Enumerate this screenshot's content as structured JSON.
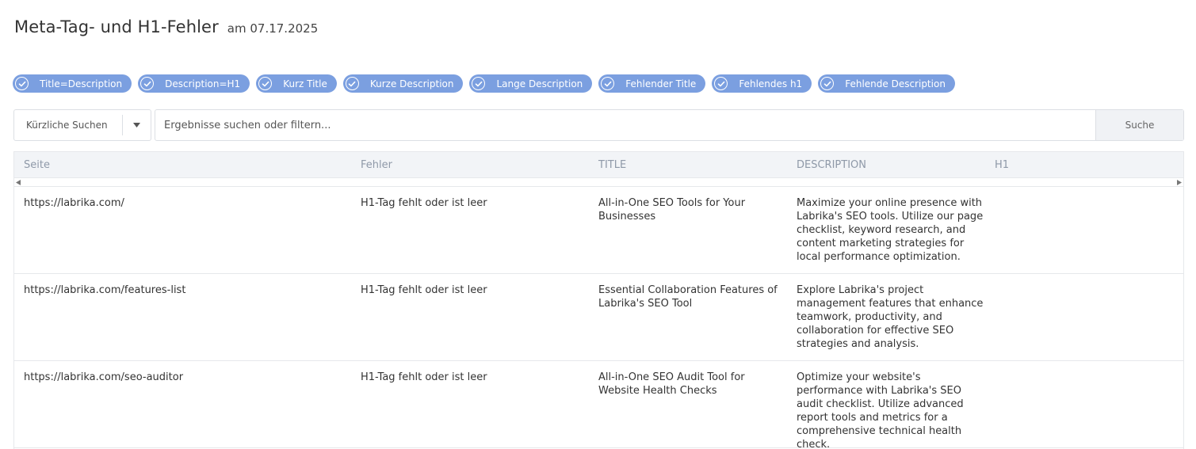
{
  "header": {
    "title": "Meta-Tag- und H1-Fehler",
    "date": "am 07.17.2025"
  },
  "filters": [
    {
      "label": "Title=Description",
      "checked": true
    },
    {
      "label": "Description=H1",
      "checked": true
    },
    {
      "label": "Kurz Title",
      "checked": true
    },
    {
      "label": "Kurze Description",
      "checked": true
    },
    {
      "label": "Lange Description",
      "checked": true
    },
    {
      "label": "Fehlender Title",
      "checked": true
    },
    {
      "label": "Fehlendes h1",
      "checked": true
    },
    {
      "label": "Fehlende Description",
      "checked": true
    }
  ],
  "search": {
    "recent_label": "Kürzliche Suchen",
    "placeholder": "Ergebnisse suchen oder filtern...",
    "value": "",
    "button_label": "Suche"
  },
  "table": {
    "columns": [
      "Seite",
      "Fehler",
      "TITLE",
      "DESCRIPTION",
      "H1"
    ],
    "rows": [
      {
        "page": "https://labrika.com/",
        "error": "H1-Tag fehlt oder ist leer",
        "title": "All-in-One SEO Tools for Your Businesses",
        "description": "Maximize your online presence with Labrika's SEO tools. Utilize our page checklist, keyword research, and content marketing strategies for local performance optimization.",
        "h1": ""
      },
      {
        "page": "https://labrika.com/features-list",
        "error": "H1-Tag fehlt oder ist leer",
        "title": "Essential Collaboration Features of Labrika's SEO Tool",
        "description": "Explore Labrika's project management features that enhance teamwork, productivity, and collaboration for effective SEO strategies and analysis.",
        "h1": ""
      },
      {
        "page": "https://labrika.com/seo-auditor",
        "error": "H1-Tag fehlt oder ist leer",
        "title": "All-in-One SEO Audit Tool for Website Health Checks",
        "description": "Optimize your website's performance with Labrika's SEO audit checklist. Utilize advanced report tools and metrics for a comprehensive technical health check.",
        "h1": ""
      }
    ]
  },
  "colors": {
    "chip_bg": "#7b9fe0",
    "header_bg": "#f2f4f7",
    "header_text": "#8f99a8",
    "border": "#e6e8eb"
  },
  "icons": {
    "chip_check": "check-circle-icon",
    "dropdown": "caret-down-icon",
    "scroll_left": "scroll-left-arrow-icon",
    "scroll_right": "scroll-right-arrow-icon"
  }
}
